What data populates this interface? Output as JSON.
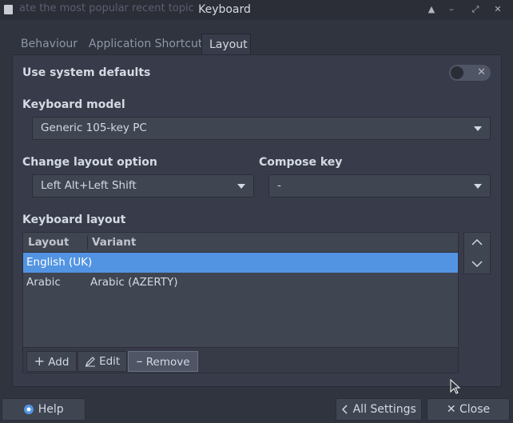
{
  "window": {
    "background_text": "ate the most popular recent topic",
    "title": "Keyboard"
  },
  "tabs": [
    {
      "label": "Behaviour",
      "active": false
    },
    {
      "label": "Application Shortcuts",
      "active": false
    },
    {
      "label": "Layout",
      "active": true
    }
  ],
  "system_defaults": {
    "label": "Use system defaults",
    "enabled": false
  },
  "keyboard_model": {
    "label": "Keyboard model",
    "value": "Generic 105-key PC"
  },
  "change_layout": {
    "label": "Change layout option",
    "value": "Left Alt+Left Shift"
  },
  "compose_key": {
    "label": "Compose key",
    "value": "-"
  },
  "keyboard_layout": {
    "label": "Keyboard layout",
    "columns": [
      "Layout",
      "Variant"
    ],
    "rows": [
      {
        "layout": "English (UK)",
        "variant": "",
        "selected": true
      },
      {
        "layout": "Arabic",
        "variant": "Arabic (AZERTY)",
        "selected": false
      }
    ],
    "buttons": {
      "add": "Add",
      "edit": "Edit",
      "remove": "Remove"
    }
  },
  "bottom_buttons": {
    "help": "Help",
    "all_settings": "All Settings",
    "close": "Close"
  },
  "colors": {
    "accent": "#5294e2",
    "background": "#383c4a"
  }
}
